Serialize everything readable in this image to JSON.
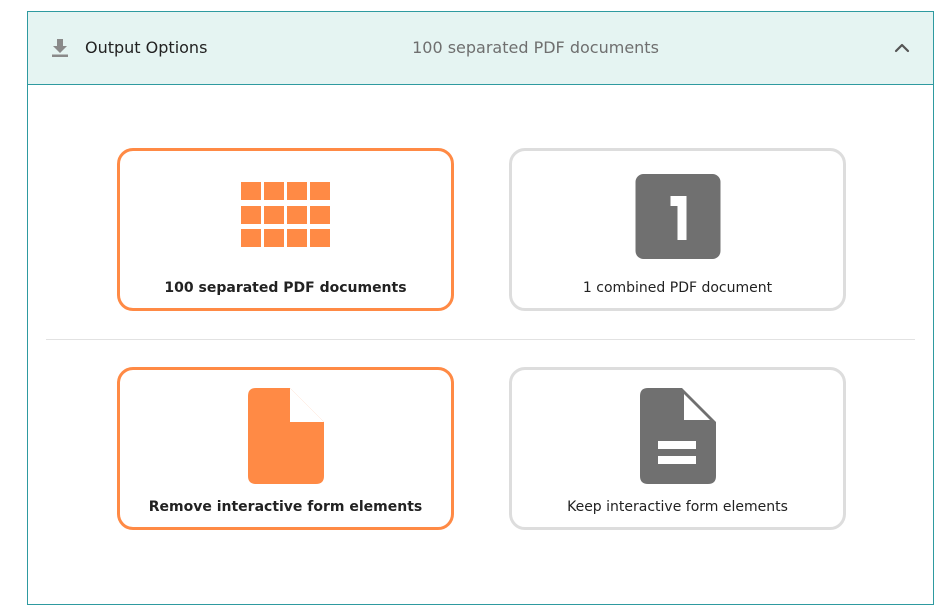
{
  "header": {
    "icon": "download-icon",
    "title": "Output Options",
    "summary": "100 separated PDF documents",
    "toggle_icon": "chevron-up-icon"
  },
  "colors": {
    "accent": "#ff8a45",
    "icon_gray": "#707070",
    "header_bg": "#e5f4f2",
    "border_teal": "#2e9aa0"
  },
  "document_options": [
    {
      "label": "100 separated PDF documents",
      "icon": "grid-icon",
      "selected": true
    },
    {
      "label": "1 combined PDF document",
      "icon": "number-one-icon",
      "selected": false
    }
  ],
  "form_options": [
    {
      "label": "Remove interactive form elements",
      "icon": "blank-document-icon",
      "selected": true
    },
    {
      "label": "Keep interactive form elements",
      "icon": "form-document-icon",
      "selected": false
    }
  ]
}
